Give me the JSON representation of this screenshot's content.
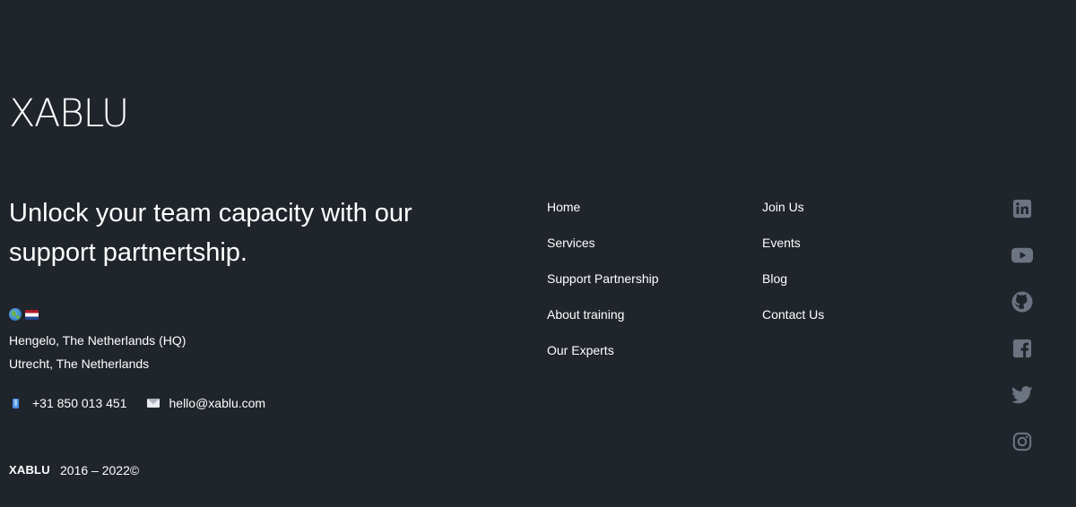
{
  "brand": {
    "logo_text": "XABLU",
    "tagline": "Unlock your team capacity with our support partnertship."
  },
  "locations": {
    "icons": [
      "globe-icon",
      "netherlands-flag-icon"
    ],
    "address_hq": "Hengelo, The Netherlands (HQ)",
    "address_2": "Utrecht, The Netherlands"
  },
  "contact": {
    "phone_icon": "phone-icon",
    "phone": "+31 850 013 451",
    "email_icon": "mail-icon",
    "email": "hello@xablu.com"
  },
  "nav": {
    "column1": [
      "Home",
      "Services",
      "Support Partnership",
      "About training",
      "Our Experts"
    ],
    "column2": [
      "Join Us",
      "Events",
      "Blog",
      "Contact Us"
    ]
  },
  "social": {
    "icons": [
      "linkedin-icon",
      "youtube-icon",
      "github-icon",
      "facebook-icon",
      "twitter-icon",
      "instagram-icon"
    ],
    "icon_color": "#6b7480"
  },
  "footer": {
    "brand": "XABLU",
    "years": "2016 – 2022©"
  },
  "colors": {
    "background": "#20242b",
    "text": "#ffffff"
  }
}
